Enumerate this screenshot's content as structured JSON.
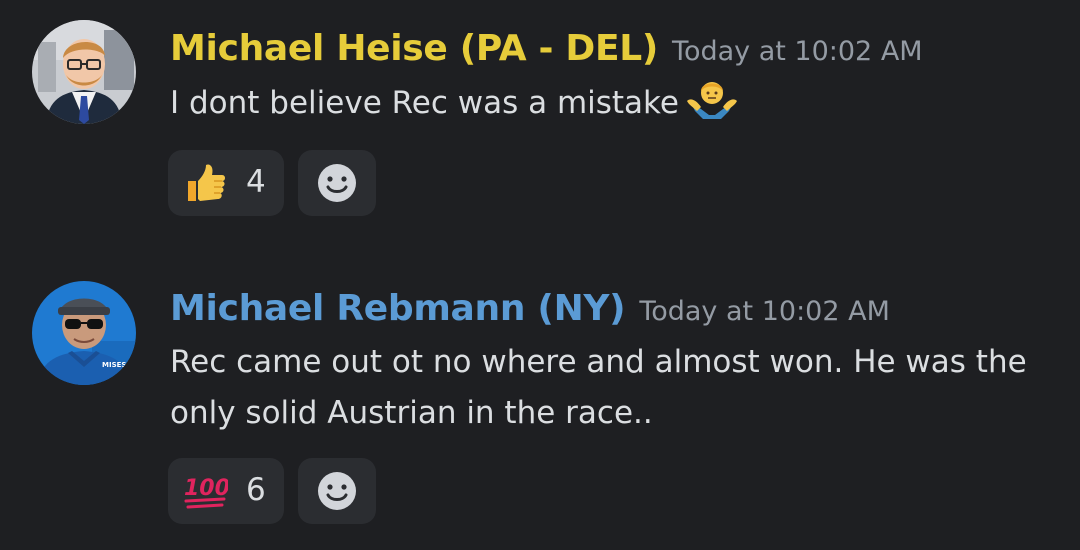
{
  "messages": [
    {
      "author": "Michael Heise (PA - DEL)",
      "author_color": "#e6cc3a",
      "timestamp": "Today at 10:02 AM",
      "text": "I dont believe Rec was a mistake",
      "inline_emoji": "person-shrugging-emoji",
      "reactions": [
        {
          "emoji": "thumbs-up-emoji",
          "count": "4"
        }
      ]
    },
    {
      "author": "Michael Rebmann (NY)",
      "author_color": "#5b9bd5",
      "timestamp": "Today at 10:02 AM",
      "text": "Rec came out ot no where and almost won. He was the only solid Austrian in the race..",
      "reactions": [
        {
          "emoji": "hundred-points-emoji",
          "count": "6"
        }
      ]
    }
  ]
}
